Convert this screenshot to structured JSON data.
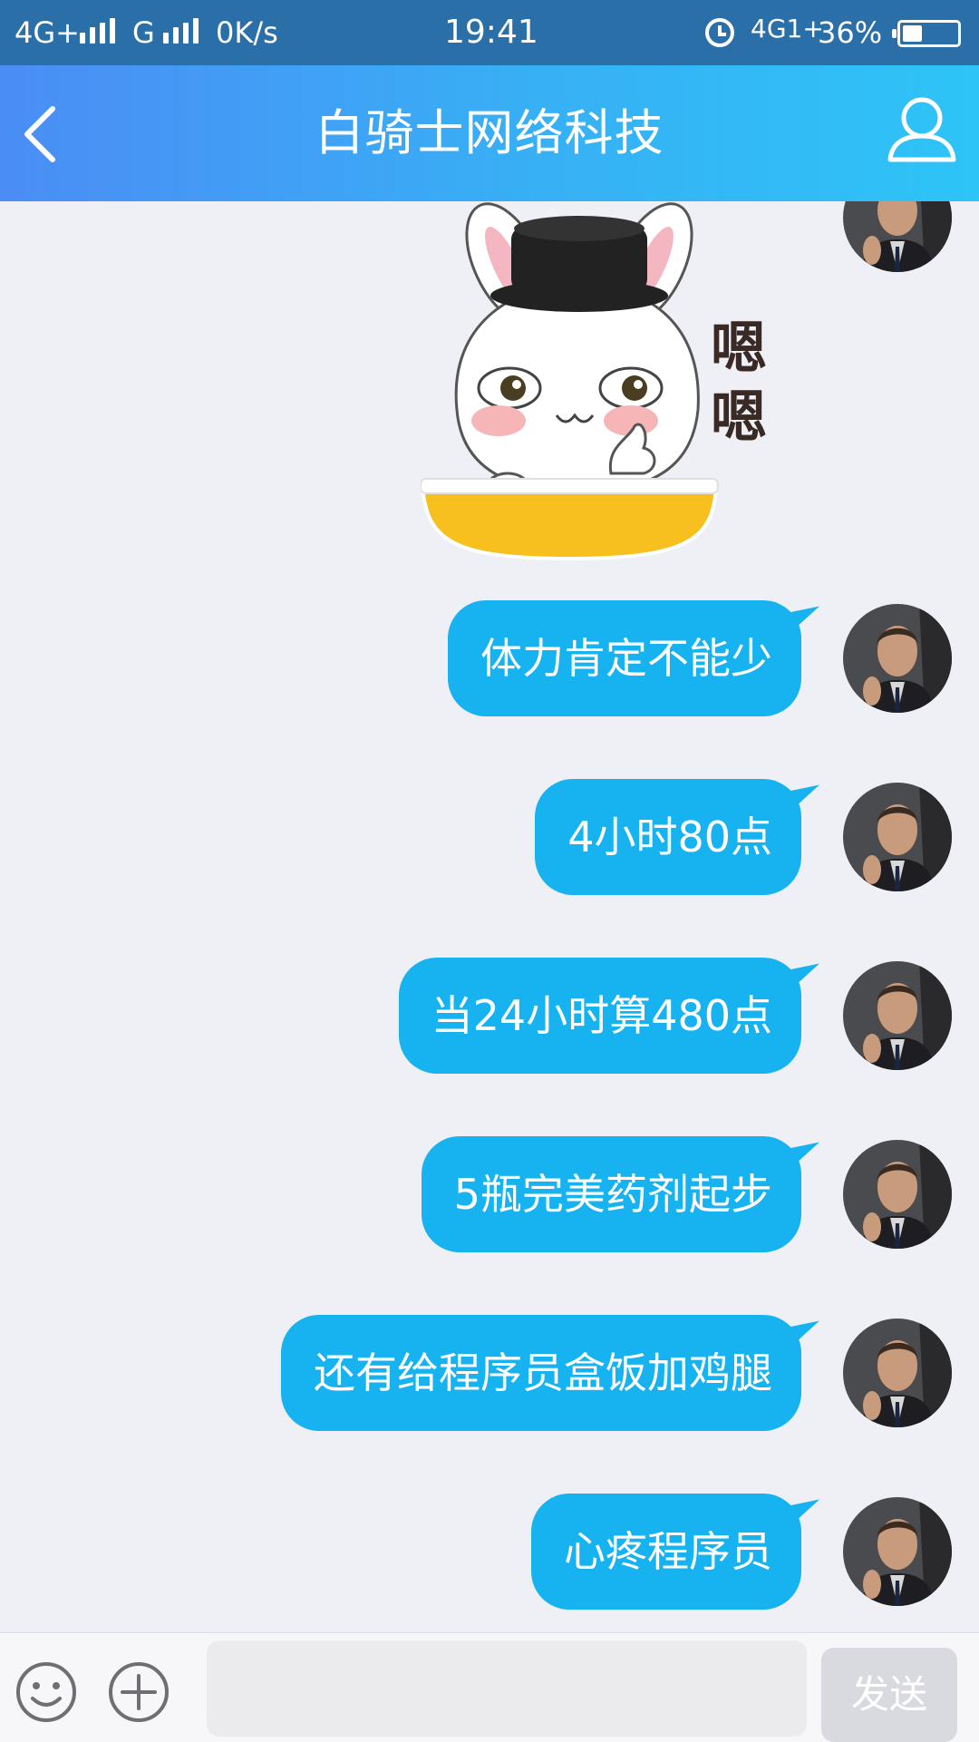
{
  "status_bar": {
    "network_left": "4G+",
    "network_mid": "G",
    "speed": "0K/s",
    "time": "19:41",
    "network_right": "4G1+",
    "battery_percent": "36%",
    "battery_level": 0.36
  },
  "header": {
    "title": "白骑士网络科技",
    "back_icon": "chevron-left-icon",
    "profile_icon": "person-icon"
  },
  "chat": {
    "sticker": {
      "caption": "嗯嗯"
    },
    "messages": [
      {
        "text": "体力肯定不能少"
      },
      {
        "text": "4小时80点"
      },
      {
        "text": "当24小时算480点"
      },
      {
        "text": "5瓶完美药剂起步"
      },
      {
        "text": "还有给程序员盒饭加鸡腿"
      },
      {
        "text": "心疼程序员"
      }
    ]
  },
  "input_bar": {
    "emoji_icon": "smiley-icon",
    "plus_icon": "plus-circle-icon",
    "input_value": "",
    "send_label": "发送"
  },
  "colors": {
    "bubble": "#17b3f1",
    "header_start": "#4b8df5",
    "header_end": "#2ec4f6",
    "status_bar": "#2a6fa8",
    "background": "#eef0f6"
  }
}
